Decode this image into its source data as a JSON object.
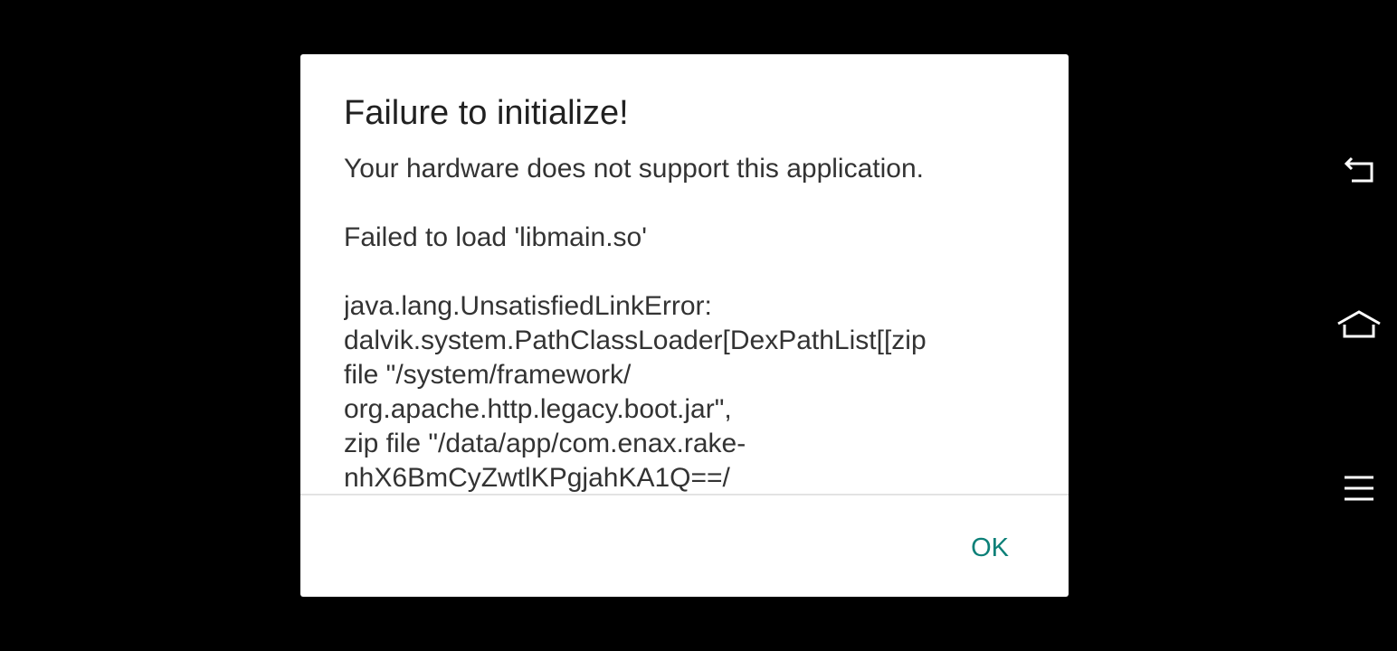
{
  "dialog": {
    "title": "Failure to initialize!",
    "message_lines": [
      "Your hardware does not support this application.",
      "",
      "Failed to load 'libmain.so'",
      "",
      "java.lang.UnsatisfiedLinkError:",
      "dalvik.system.PathClassLoader[DexPathList[[zip",
      "file \"/system/framework/",
      "org.apache.http.legacy.boot.jar\",",
      "zip file \"/data/app/com.enax.rake-",
      "nhX6BmCyZwtlKPgjahKA1Q==/"
    ],
    "ok_label": "OK"
  },
  "navigation_bar": {
    "back_icon": "back-icon",
    "home_icon": "home-icon",
    "menu_icon": "menu-icon"
  },
  "colors": {
    "background": "#000000",
    "dialog_background": "#ffffff",
    "accent": "#0d8078",
    "divider": "#e3e3e3"
  }
}
